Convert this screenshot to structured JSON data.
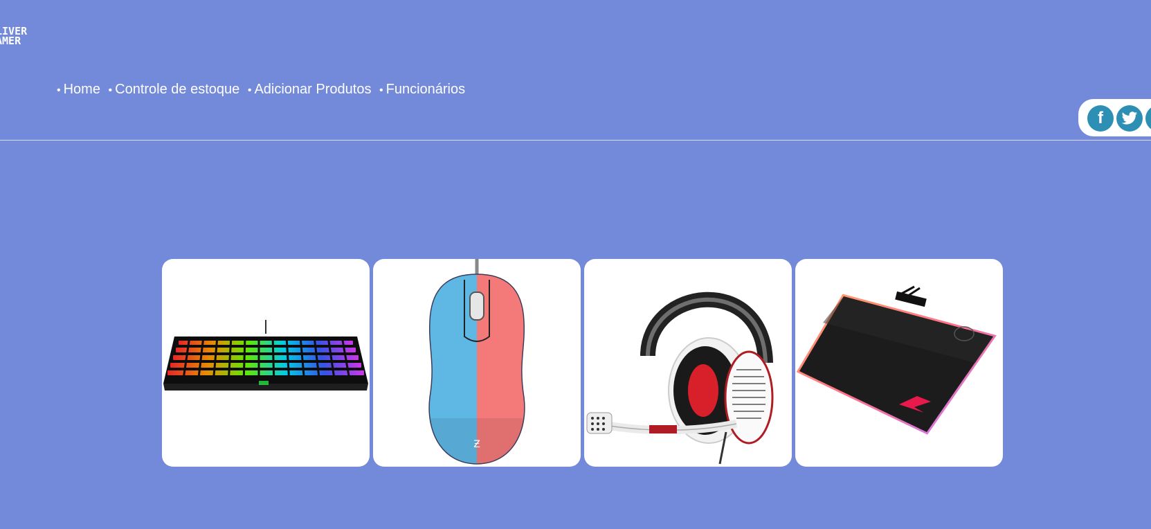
{
  "logo": {
    "line1": "LIVER",
    "line2": "AMER"
  },
  "nav": {
    "items": [
      {
        "label": "Home"
      },
      {
        "label": "Controle de estoque"
      },
      {
        "label": "Adicionar Produtos"
      },
      {
        "label": "Funcionários"
      }
    ],
    "bullet": "•"
  },
  "social": {
    "icons": [
      "facebook-icon",
      "twitter-icon",
      "instagram-icon"
    ],
    "color": "#2c8fb3",
    "facebook_glyph": "f"
  },
  "products": [
    {
      "name": "keyboard-image"
    },
    {
      "name": "mouse-image"
    },
    {
      "name": "headset-image"
    },
    {
      "name": "mousepad-image"
    }
  ],
  "colors": {
    "background": "#7389da",
    "card": "#ffffff"
  }
}
